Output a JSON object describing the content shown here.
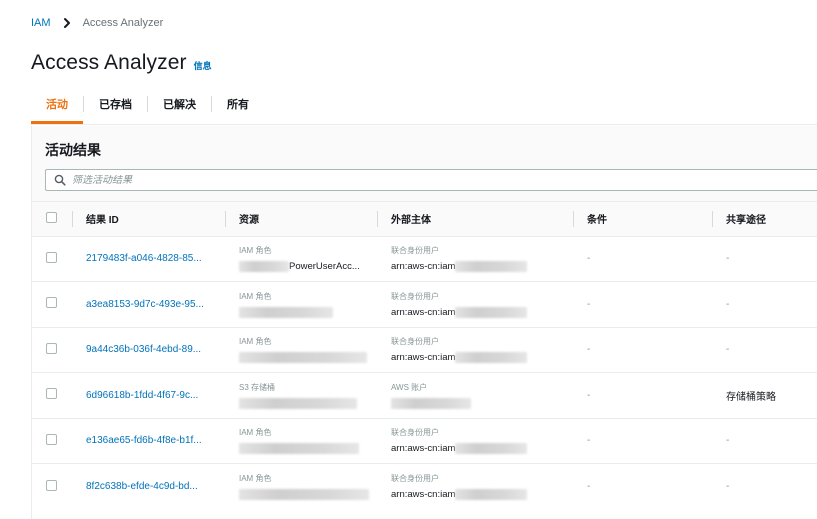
{
  "breadcrumb": {
    "root": "IAM",
    "current": "Access Analyzer"
  },
  "page": {
    "title": "Access Analyzer",
    "info": "信息"
  },
  "tabs": [
    {
      "label": "活动",
      "active": true
    },
    {
      "label": "已存档",
      "active": false
    },
    {
      "label": "已解决",
      "active": false
    },
    {
      "label": "所有",
      "active": false
    }
  ],
  "panel": {
    "title": "活动结果",
    "filter_placeholder": "筛选活动结果"
  },
  "table": {
    "headers": [
      "结果 ID",
      "资源",
      "外部主体",
      "条件",
      "共享途径"
    ],
    "rows": [
      {
        "id": "2179483f-a046-4828-85...",
        "resource_type": "IAM 角色",
        "resource_name": "PowerUserAcc...",
        "principal_type": "联合身份用户",
        "principal_name": "arn:aws-cn:iam",
        "condition": "-",
        "via": "-"
      },
      {
        "id": "a3ea8153-9d7c-493e-95...",
        "resource_type": "IAM 角色",
        "resource_name": "",
        "principal_type": "联合身份用户",
        "principal_name": "arn:aws-cn:iam",
        "condition": "-",
        "via": "-"
      },
      {
        "id": "9a44c36b-036f-4ebd-89...",
        "resource_type": "IAM 角色",
        "resource_name": "",
        "principal_type": "联合身份用户",
        "principal_name": "arn:aws-cn:iam",
        "condition": "-",
        "via": "-"
      },
      {
        "id": "6d96618b-1fdd-4f67-9c...",
        "resource_type": "S3 存储桶",
        "resource_name": "",
        "principal_type": "AWS 账户",
        "principal_name": "",
        "condition": "-",
        "via": "存储桶策略"
      },
      {
        "id": "e136ae65-fd6b-4f8e-b1f...",
        "resource_type": "IAM 角色",
        "resource_name": "",
        "principal_type": "联合身份用户",
        "principal_name": "arn:aws-cn:iam",
        "condition": "-",
        "via": "-"
      },
      {
        "id": "8f2c638b-efde-4c9d-bd...",
        "resource_type": "IAM 角色",
        "resource_name": "",
        "principal_type": "联合身份用户",
        "principal_name": "arn:aws-cn:iam",
        "condition": "-",
        "via": "-"
      }
    ]
  },
  "colors": {
    "accent": "#ec7211",
    "link": "#0073bb"
  }
}
